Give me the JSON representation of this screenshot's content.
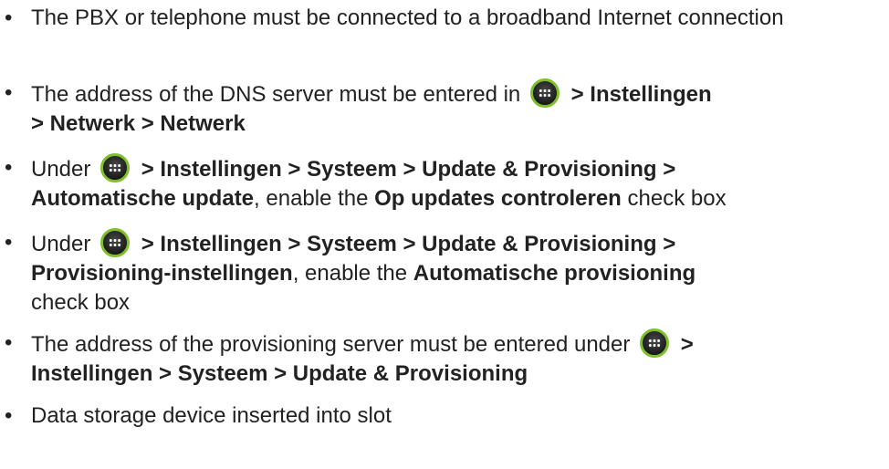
{
  "bullet_symbol": "•",
  "icon": {
    "name": "apps-grid-icon",
    "ring_color": "#7fbf2a",
    "fill_color": "#1a1a1a"
  },
  "items": [
    {
      "text": "The PBX or telephone must be connected to a broadband Internet connection"
    },
    {
      "text_before": "The address of the DNS server must be entered in",
      "path_after_icon": "> Instellingen",
      "path_line2": "> Netwerk > Netwerk"
    },
    {
      "text_before": "Under",
      "path_after_icon": "> Instellingen > Systeem > Update & Provisioning >",
      "path_line2_bold": "Automatische update",
      "middle": ", enable the ",
      "checkbox_bold": "Op updates controleren",
      "tail": " check box"
    },
    {
      "text_before": "Under",
      "path_after_icon": "> Instellingen > Systeem > Update & Provisioning >",
      "path_line2_bold": "Provisioning-instellingen",
      "middle": ", enable the ",
      "checkbox_bold": "Automatische provisioning",
      "tail": "check box"
    },
    {
      "text_before": "The address of the provisioning server must be entered under",
      "path_after_icon": ">",
      "path_line2": "Instellingen > Systeem > Update & Provisioning"
    },
    {
      "text": "Data storage device inserted into slot"
    }
  ]
}
